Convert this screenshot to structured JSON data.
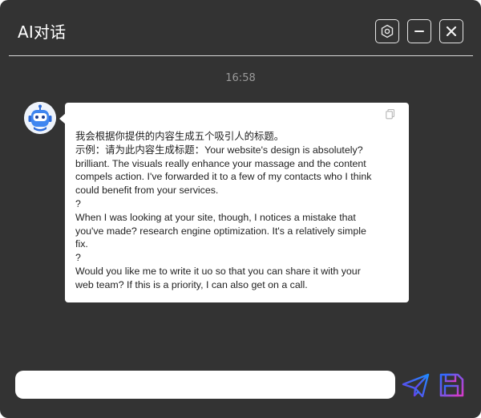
{
  "window": {
    "title": "AI对话"
  },
  "header": {
    "icons": {
      "settings": "hexagon-settings-icon",
      "minimize": "minimize-icon",
      "close": "close-icon"
    }
  },
  "chat": {
    "timestamp": "16:58",
    "messages": [
      {
        "sender_icon": "robot-avatar-icon",
        "lines": [
          "我会根据你提供的内容生成五个吸引人的标题。",
          "示例：请为此内容生成标题：Your website's design is absolutely?",
          "brilliant. The visuals really enhance your massage and the content",
          "compels action. I've forwarded it to a few of my contacts who I think",
          "could benefit from your services.",
          "?",
          "When I was looking at your site, though, I notices a mistake that",
          "you've made? research engine optimization. It's a relatively simple",
          "fix.",
          "?",
          "Would you like me to write it uo so that you can share it with your",
          "web team? If this is a priority, I can also get on a call."
        ]
      }
    ]
  },
  "composer": {
    "input_value": "",
    "placeholder": "",
    "send_icon": "paper-plane-send-icon",
    "save_icon": "floppy-disk-save-icon"
  },
  "colors": {
    "background": "#333333",
    "bubble": "#ffffff",
    "text": "#222222",
    "timestamp": "#9a9a9a",
    "send_gradient_start": "#6a3de8",
    "send_gradient_end": "#1e8bff",
    "save_gradient_start": "#2f6bff",
    "save_gradient_end": "#d63ac9"
  }
}
